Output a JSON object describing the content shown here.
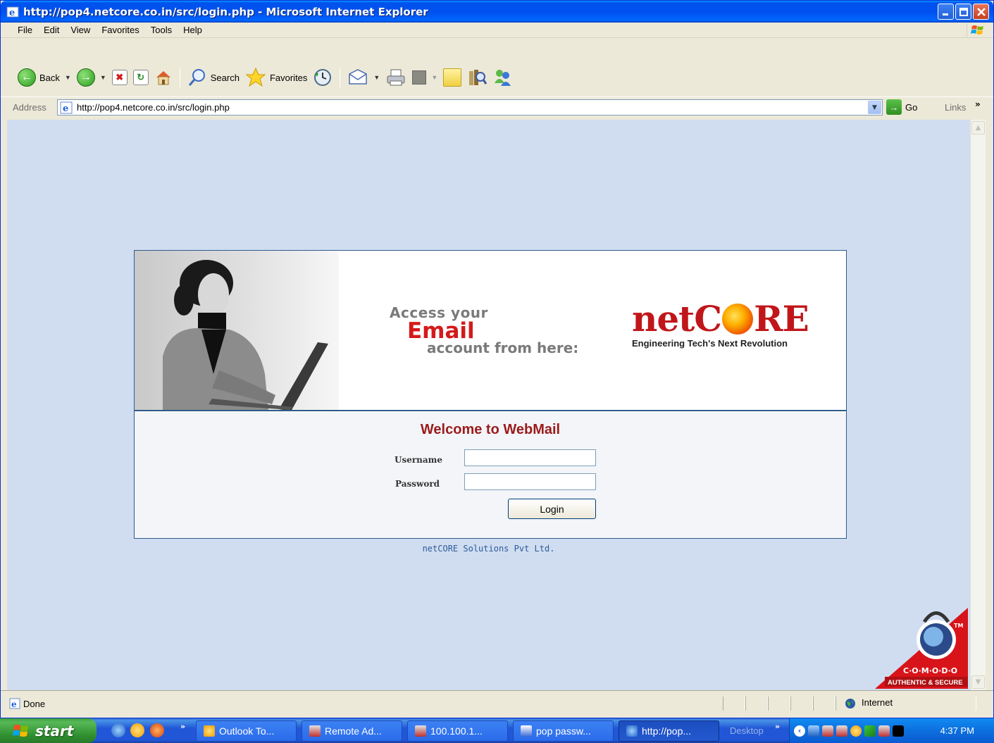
{
  "window": {
    "title": "http://pop4.netcore.co.in/src/login.php - Microsoft Internet Explorer",
    "controls": [
      "minimize",
      "maximize",
      "close"
    ]
  },
  "menubar": {
    "items": [
      "File",
      "Edit",
      "View",
      "Favorites",
      "Tools",
      "Help"
    ]
  },
  "toolbar": {
    "back_label": "Back",
    "search_label": "Search",
    "favorites_label": "Favorites"
  },
  "address": {
    "label": "Address",
    "url": "http://pop4.netcore.co.in/src/login.php",
    "go_label": "Go",
    "links_label": "Links"
  },
  "page": {
    "tagline_access": "Access your",
    "tagline_email": "Email",
    "tagline_from": "account from here:",
    "brand_net": "net",
    "brand_c": "C",
    "brand_re": "RE",
    "brand_subtitle": "Engineering Tech's Next Revolution",
    "welcome": "Welcome to WebMail",
    "username_label": "Username",
    "password_label": "Password",
    "username_value": "",
    "password_value": "",
    "login_button": "Login",
    "footer": "netCORE Solutions Pvt Ltd."
  },
  "comodo": {
    "name": "C·O·M·O·D·O",
    "tagline": "AUTHENTIC & SECURE",
    "tm": "TM"
  },
  "statusbar": {
    "status": "Done",
    "zone": "Internet"
  },
  "taskbar": {
    "start_label": "start",
    "tasks": [
      {
        "label": "Outlook To..."
      },
      {
        "label": "Remote Ad..."
      },
      {
        "label": "100.100.1..."
      },
      {
        "label": "pop passw..."
      },
      {
        "label": "http://pop..."
      }
    ],
    "desktop_label": "Desktop",
    "clock": "4:37 PM"
  }
}
